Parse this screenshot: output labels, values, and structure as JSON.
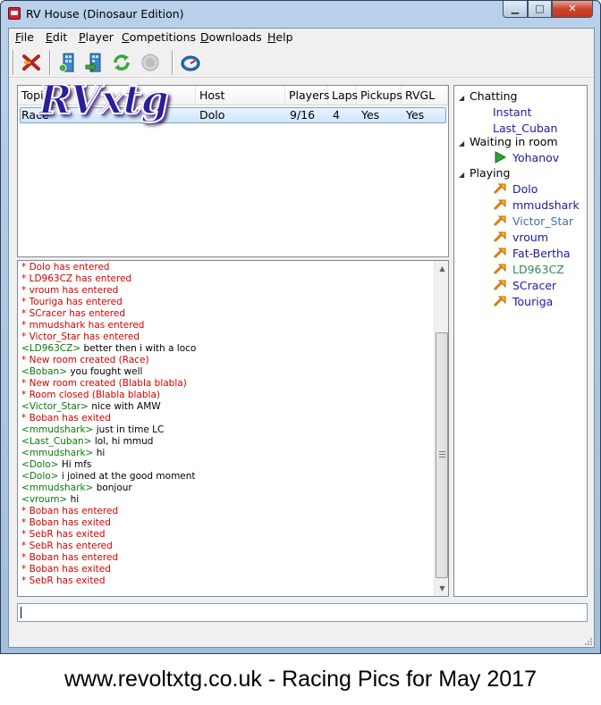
{
  "window": {
    "title": "RV House (Dinosaur Edition)",
    "minimize_glyph": "▁",
    "maximize_glyph": "□",
    "close_glyph": "✕"
  },
  "menubar": {
    "items": [
      "File",
      "Edit",
      "Player",
      "Competitions",
      "Downloads",
      "Help"
    ]
  },
  "toolbar": {
    "icons": [
      "disconnect-icon",
      "create-room-icon",
      "join-room-icon",
      "refresh-icon",
      "disabled-icon",
      "speedometer-icon"
    ]
  },
  "rooms_table": {
    "columns": [
      "Topic",
      "Host",
      "Players",
      "Laps",
      "Pickups",
      "RVGL"
    ],
    "rows": [
      {
        "topic": "Race",
        "host": "Dolo",
        "players": "9/16",
        "laps": "4",
        "pickups": "Yes",
        "rvgl": "Yes"
      }
    ]
  },
  "logo": {
    "text": "RVxtg"
  },
  "chat": {
    "lines": [
      {
        "type": "sys",
        "text": "* Dolo has entered"
      },
      {
        "type": "sys",
        "text": "* LD963CZ has entered"
      },
      {
        "type": "sys",
        "text": "* vroum has entered"
      },
      {
        "type": "sys",
        "text": "* Touriga has entered"
      },
      {
        "type": "sys",
        "text": "* SCracer has entered"
      },
      {
        "type": "sys",
        "text": "* mmudshark has entered"
      },
      {
        "type": "sys",
        "text": "* Victor_Star has entered"
      },
      {
        "type": "msg",
        "nick": "LD963CZ",
        "text": "better then i with a loco"
      },
      {
        "type": "sys",
        "text": "* New room created (Race)"
      },
      {
        "type": "msg",
        "nick": "Boban",
        "text": "you fought well"
      },
      {
        "type": "sys",
        "text": "* New room created (Blabla blabla)"
      },
      {
        "type": "sys",
        "text": "* Room closed (Blabla blabla)"
      },
      {
        "type": "msg",
        "nick": "Victor_Star",
        "text": "nice with AMW"
      },
      {
        "type": "sys",
        "text": "* Boban has exited"
      },
      {
        "type": "msg",
        "nick": "mmudshark",
        "text": "just in time LC"
      },
      {
        "type": "msg",
        "nick": "Last_Cuban",
        "text": "lol, hi mmud"
      },
      {
        "type": "msg",
        "nick": "mmudshark",
        "text": "hi"
      },
      {
        "type": "msg",
        "nick": "Dolo",
        "text": "Hi mfs"
      },
      {
        "type": "msg",
        "nick": "Dolo",
        "text": "i joined at the good moment"
      },
      {
        "type": "msg",
        "nick": "mmudshark",
        "text": "bonjour"
      },
      {
        "type": "msg",
        "nick": "vroum",
        "text": "hi"
      },
      {
        "type": "sys",
        "text": "* Boban has entered"
      },
      {
        "type": "sys",
        "text": "* Boban has exited"
      },
      {
        "type": "sys",
        "text": "* SebR has exited"
      },
      {
        "type": "sys",
        "text": "* SebR has entered"
      },
      {
        "type": "sys",
        "text": "* Boban has entered"
      },
      {
        "type": "sys",
        "text": "* Boban has exited"
      },
      {
        "type": "sys",
        "text": "* SebR has exited"
      }
    ],
    "colors": {
      "system": "#d40000",
      "nick": "#0a7a0a",
      "text": "#000000"
    }
  },
  "users": {
    "groups": [
      {
        "label": "Chatting",
        "users": [
          {
            "name": "Instant",
            "color": "#1a1aa6",
            "icon": ""
          },
          {
            "name": "Last_Cuban",
            "color": "#1a1aa6",
            "icon": ""
          }
        ]
      },
      {
        "label": "Waiting in room",
        "users": [
          {
            "name": "Yohanov",
            "color": "#1a1aa6",
            "icon": "play-icon"
          }
        ]
      },
      {
        "label": "Playing",
        "users": [
          {
            "name": "Dolo",
            "color": "#1a1aa6",
            "icon": "racing-icon"
          },
          {
            "name": "mmudshark",
            "color": "#1a1aa6",
            "icon": "racing-icon"
          },
          {
            "name": "Victor_Star",
            "color": "#4a6fa5",
            "icon": "racing-icon"
          },
          {
            "name": "vroum",
            "color": "#1a1aa6",
            "icon": "racing-icon"
          },
          {
            "name": "Fat-Bertha",
            "color": "#1a1aa6",
            "icon": "racing-icon"
          },
          {
            "name": "LD963CZ",
            "color": "#2e8b57",
            "icon": "racing-icon"
          },
          {
            "name": "SCracer",
            "color": "#1a1aa6",
            "icon": "racing-icon"
          },
          {
            "name": "Touriga",
            "color": "#1a1aa6",
            "icon": "racing-icon"
          }
        ]
      }
    ]
  },
  "input": {
    "value": ""
  },
  "footer": {
    "caption": "www.revoltxtg.co.uk - Racing Pics for May 2017"
  }
}
